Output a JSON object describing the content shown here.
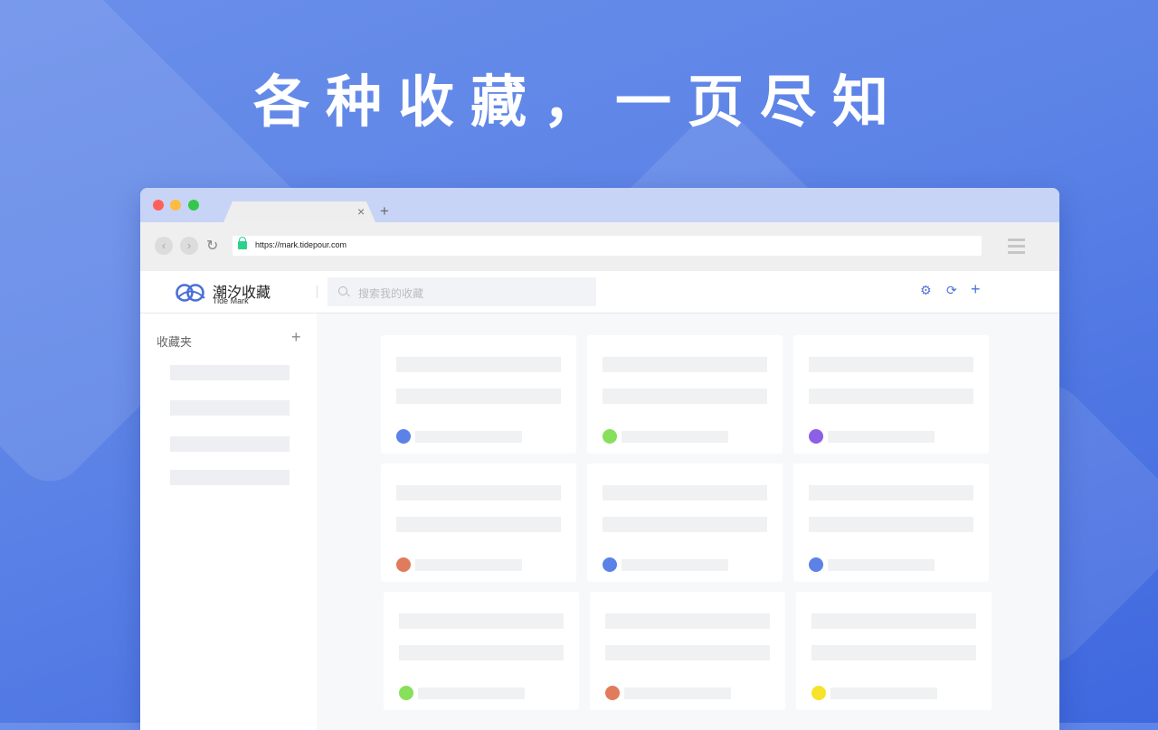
{
  "headline": "各种收藏，一页尽知",
  "browser": {
    "url": "https://mark.tidepour.com",
    "tab_close": "×",
    "tab_new": "+"
  },
  "app": {
    "brand_cn": "潮汐收藏",
    "brand_en": "Tide Mark",
    "search_placeholder": "搜索我的收藏",
    "sidebar_title": "收藏夹",
    "sidebar_add": "+",
    "add_label": "+"
  },
  "colors": {
    "accent": "#4e73d8",
    "avatar_blue": "#5b82e6",
    "avatar_green": "#86e05b",
    "avatar_purple": "#8c5fe6",
    "avatar_orange": "#e07c5b",
    "avatar_yellow": "#f6e32a"
  },
  "icons": [
    "lock-icon",
    "search-icon",
    "settings-icon",
    "sync-icon",
    "add-icon",
    "menu-icon"
  ],
  "cards": [
    {
      "avatar_color": "#5b82e6"
    },
    {
      "avatar_color": "#86e05b"
    },
    {
      "avatar_color": "#8c5fe6"
    },
    {
      "avatar_color": "#e07c5b"
    },
    {
      "avatar_color": "#5b82e6"
    },
    {
      "avatar_color": "#5b82e6"
    },
    {
      "avatar_color": "#86e05b"
    },
    {
      "avatar_color": "#e07c5b"
    },
    {
      "avatar_color": "#f6e32a"
    }
  ]
}
